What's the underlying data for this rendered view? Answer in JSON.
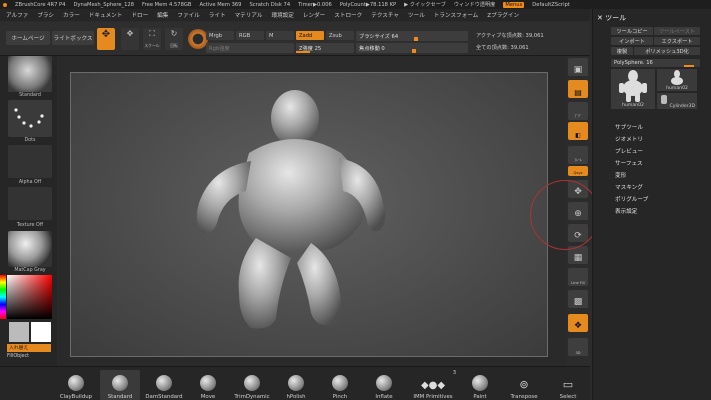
{
  "titlebar": {
    "items": [
      "ZBrushCore 4R7 P4",
      "DynaMesh_Sphere_128",
      "Free Mem 4.578GB",
      "Active Mem 369",
      "Scratch Disk 74",
      "Timer▶0.006",
      "PolyCount▶78.118 KP",
      "▶ クイックセーブ",
      "ウィンドウ透明度"
    ],
    "menus_label": "Menus",
    "script_label": "DefaultZScript"
  },
  "menubar": [
    "アルファ",
    "ブラシ",
    "カラー",
    "ドキュメント",
    "ドロー",
    "編集",
    "ファイル",
    "ライト",
    "マテリアル",
    "環境設定",
    "レンダー",
    "ストローク",
    "テクスチャ",
    "ツール",
    "トランスフォーム",
    "Zプラグイン"
  ],
  "shelf": {
    "home": "ホームページ",
    "lightbox": "ライトボックス",
    "draw_label": "",
    "scale_label": "スケール",
    "rotate_label": "回転",
    "mrgb": "Mrgb",
    "rgb": "RGB",
    "m": "M",
    "zadd": "Zadd",
    "zsub": "Zsub",
    "rgb_intensity": "Rgb強度",
    "zintensity": "Z強度 25",
    "draw_size": "ブラシサイズ 64",
    "focal_shift": "焦点移動 0",
    "active_points": "アクティブな頂点数: 39,061",
    "total_points": "全ての頂点数: 39,061"
  },
  "left": {
    "brush": "Standard",
    "stroke": "Dots",
    "alpha": "Alpha Off",
    "texture": "Texture Off",
    "material": "MatCap Gray",
    "switch": "入れ替え",
    "fill": "FillObject"
  },
  "rtools": [
    "",
    "",
    "ﾌﾞｸﾞ",
    "",
    "ﾌﾚｰﾑ",
    "Qxyz",
    "",
    "",
    "",
    "",
    "Line Fill",
    "",
    "ﾎﾟﾘﾌ",
    "",
    "3D"
  ],
  "rpanel": {
    "title": "ツール",
    "copy": "ツールコピー",
    "paste": "ツールペースト",
    "import": "インポート",
    "export": "エクスポート",
    "clone": "複製",
    "polymesh": "ポリメッシュ3D化",
    "polysphere": "PolySphere. 16",
    "thumb1": "human02",
    "thumb2": "human02",
    "thumb3": "Cylinder3D",
    "menu": [
      "サブツール",
      "ジオメトリ",
      "プレビュー",
      "サーフェス",
      "変形",
      "マスキング",
      "ポリグループ",
      "表示設定"
    ]
  },
  "bottom": {
    "brushes": [
      "ClayBuildup",
      "Standard",
      "DamStandard",
      "Move",
      "TrimDynamic",
      "hPolish",
      "Pinch",
      "Inflate",
      "IMM Primitives",
      "Paint",
      "Transpose",
      "Select"
    ],
    "imm_count": "3"
  },
  "colors": {
    "accent": "#f08a19",
    "bg": "#2b2b2b",
    "canvas": "#4e4e4e"
  }
}
